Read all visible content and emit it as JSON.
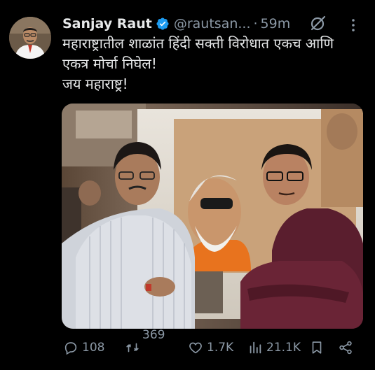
{
  "author": {
    "name": "Sanjay Raut",
    "handle": "@rautsan...",
    "separator": "·",
    "time": "59m"
  },
  "tweet": {
    "lines": [
      "महाराष्ट्रातील शाळांत हिंदी सक्ती विरोधात एकच आणि",
      "एकत्र मोर्चा निघेल!",
      "जय महाराष्ट्र!"
    ]
  },
  "icons": {
    "verified": "verified-badge-icon",
    "grok": "grok-icon",
    "more": "more-icon",
    "reply": "reply-icon",
    "retweet": "retweet-icon",
    "like": "heart-icon",
    "views": "views-icon",
    "bookmark": "bookmark-icon",
    "share": "share-icon"
  },
  "colors": {
    "background": "#000000",
    "text": "#e7e9ea",
    "muted": "#8b98a5",
    "verified": "#1d9bf0"
  },
  "actions": {
    "replies": "108",
    "retweets": "369",
    "likes": "1.7K",
    "views": "21.1K"
  }
}
